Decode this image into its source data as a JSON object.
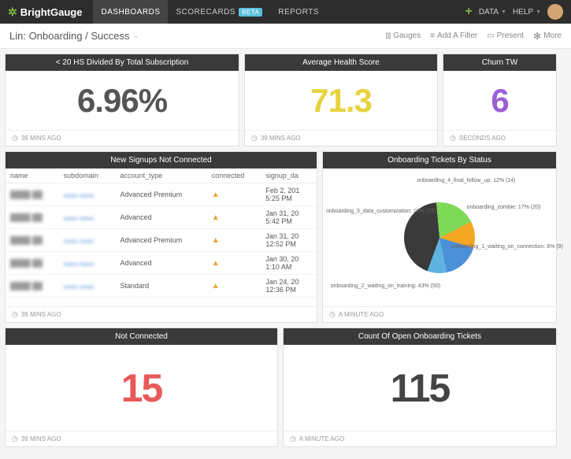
{
  "nav": {
    "brand": "BrightGauge",
    "items": [
      "DASHBOARDS",
      "SCORECARDS",
      "REPORTS"
    ],
    "beta": "BETA",
    "data": "DATA",
    "help": "HELP"
  },
  "sub": {
    "crumb": "Lin: Onboarding / Success",
    "gauges": "Gauges",
    "filter": "Add A Filter",
    "present": "Present",
    "more": "More"
  },
  "cards": {
    "hs": {
      "title": "< 20 HS Divided By Total Subscription",
      "value": "6.96%",
      "time": "39 MINS AGO"
    },
    "avg": {
      "title": "Average Health Score",
      "value": "71.3",
      "time": "39 MINS AGO"
    },
    "churn": {
      "title": "Churn TW",
      "value": "6",
      "time": "SECONDS AGO"
    },
    "signups": {
      "title": "New Signups Not Connected",
      "cols": [
        "name",
        "subdomain",
        "account_type",
        "connected",
        "signup_da"
      ],
      "rows": [
        {
          "acct": "Advanced Premium",
          "date": "Feb 2, 201",
          "time": "5:25 PM"
        },
        {
          "acct": "Advanced",
          "date": "Jan 31, 20",
          "time": "5:42 PM"
        },
        {
          "acct": "Advanced Premium",
          "date": "Jan 31, 20",
          "time": "12:52 PM"
        },
        {
          "acct": "Advanced",
          "date": "Jan 30, 20",
          "time": "1:10 AM"
        },
        {
          "acct": "Standard",
          "date": "Jan 24, 20",
          "time": "12:36 PM"
        }
      ],
      "time": "39 MINS AGO"
    },
    "pie": {
      "title": "Onboarding Tickets By Status",
      "time": "A MINUTE AGO"
    },
    "notconn": {
      "title": "Not Connected",
      "value": "15",
      "time": "39 MINS AGO"
    },
    "open": {
      "title": "Count Of Open Onboarding Tickets",
      "value": "115",
      "time": "A MINUTE AGO"
    }
  },
  "chart_data": {
    "type": "pie",
    "title": "Onboarding Tickets By Status",
    "series": [
      {
        "name": "onboarding_2_waiting_on_training",
        "percent": 43,
        "count": 50,
        "label": "onboarding_2_waiting_on_training: 43% (50)",
        "color": "#3a3a3a"
      },
      {
        "name": "onboarding_3_data_customization",
        "percent": 19,
        "count": 22,
        "label": "onboarding_3_data_customization: 19% (22)",
        "color": "#7ed957"
      },
      {
        "name": "onboarding_4_final_follow_up",
        "percent": 12,
        "count": 14,
        "label": "onboarding_4_final_follow_up: 12% (14)",
        "color": "#f5a623"
      },
      {
        "name": "onboarding_zombie",
        "percent": 17,
        "count": 20,
        "label": "onboarding_zombie: 17% (20)",
        "color": "#4a90d9"
      },
      {
        "name": "onboarding_1_waiting_on_connection",
        "percent": 8,
        "count": 9,
        "label": "onboarding_1_waiting_on_connection: 8% (9)",
        "color": "#5fb3e0"
      }
    ]
  }
}
